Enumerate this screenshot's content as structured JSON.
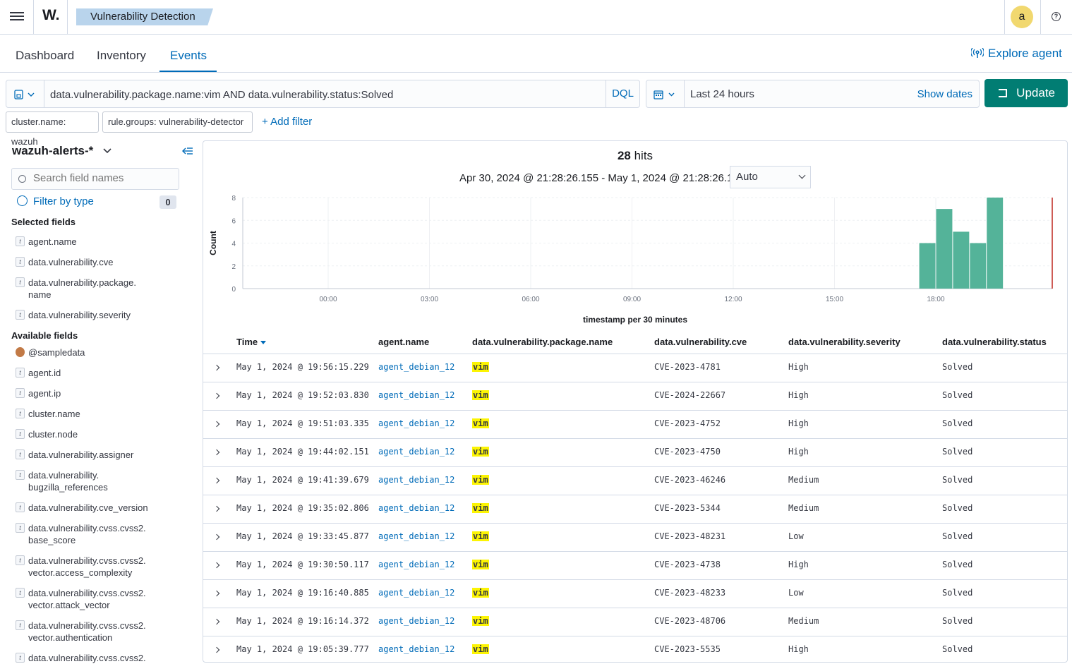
{
  "header": {
    "logo": "W.",
    "breadcrumb": "Vulnerability Detection",
    "avatar_initial": "a",
    "help_icon": "?"
  },
  "tabs": [
    {
      "label": "Dashboard",
      "active": false
    },
    {
      "label": "Inventory",
      "active": false
    },
    {
      "label": "Events",
      "active": true
    }
  ],
  "explore_agent": "Explore agent",
  "query": {
    "text": "data.vulnerability.package.name:vim AND data.vulnerability.status:Solved",
    "language": "DQL"
  },
  "date_picker": {
    "range": "Last 24 hours",
    "show_dates": "Show dates",
    "update": "Update"
  },
  "filters": [
    "cluster.name: wazuh",
    "rule.groups: vulnerability-detector"
  ],
  "add_filter": "+ Add filter",
  "sidebar": {
    "index_pattern": "wazuh-alerts-*",
    "search_placeholder": "Search field names",
    "filter_by_type": "Filter by type",
    "filter_count": "0",
    "selected_title": "Selected fields",
    "selected_fields": [
      "agent.name",
      "data.vulnerability.cve",
      "data.vulnerability.package.\nname",
      "data.vulnerability.severity"
    ],
    "available_title": "Available fields",
    "available_fields": [
      "@sampledata",
      "agent.id",
      "agent.ip",
      "cluster.name",
      "cluster.node",
      "data.vulnerability.assigner",
      "data.vulnerability.\nbugzilla_references",
      "data.vulnerability.cve_version",
      "data.vulnerability.cvss.cvss2.\nbase_score",
      "data.vulnerability.cvss.cvss2.\nvector.access_complexity",
      "data.vulnerability.cvss.cvss2.\nvector.attack_vector",
      "data.vulnerability.cvss.cvss2.\nvector.authentication",
      "data.vulnerability.cvss.cvss2."
    ]
  },
  "histogram": {
    "hits_count": "28",
    "hits_label": "hits",
    "date_range": "Apr 30, 2024 @ 21:28:26.155 - May 1, 2024 @ 21:28:26.155",
    "interval": "Auto"
  },
  "chart_data": {
    "type": "bar",
    "xlabel": "timestamp per 30 minutes",
    "ylabel": "Count",
    "ylim": [
      0,
      8
    ],
    "yticks": [
      "0",
      "2",
      "4",
      "6",
      "8"
    ],
    "xticks": [
      "00:00",
      "03:00",
      "06:00",
      "09:00",
      "12:00",
      "15:00",
      "18:00"
    ],
    "categories": [
      "17:30",
      "18:00",
      "18:30",
      "19:00",
      "19:30"
    ],
    "values": [
      4,
      7,
      5,
      4,
      8
    ],
    "color": "#54b399",
    "now_marker_color": "#bd271e"
  },
  "table": {
    "columns": [
      "Time",
      "agent.name",
      "data.vulnerability.package.name",
      "data.vulnerability.cve",
      "data.vulnerability.severity",
      "data.vulnerability.status"
    ],
    "rows": [
      [
        "May 1, 2024 @ 19:56:15.229",
        "agent_debian_12",
        "vim",
        "CVE-2023-4781",
        "High",
        "Solved"
      ],
      [
        "May 1, 2024 @ 19:52:03.830",
        "agent_debian_12",
        "vim",
        "CVE-2024-22667",
        "High",
        "Solved"
      ],
      [
        "May 1, 2024 @ 19:51:03.335",
        "agent_debian_12",
        "vim",
        "CVE-2023-4752",
        "High",
        "Solved"
      ],
      [
        "May 1, 2024 @ 19:44:02.151",
        "agent_debian_12",
        "vim",
        "CVE-2023-4750",
        "High",
        "Solved"
      ],
      [
        "May 1, 2024 @ 19:41:39.679",
        "agent_debian_12",
        "vim",
        "CVE-2023-46246",
        "Medium",
        "Solved"
      ],
      [
        "May 1, 2024 @ 19:35:02.806",
        "agent_debian_12",
        "vim",
        "CVE-2023-5344",
        "Medium",
        "Solved"
      ],
      [
        "May 1, 2024 @ 19:33:45.877",
        "agent_debian_12",
        "vim",
        "CVE-2023-48231",
        "Low",
        "Solved"
      ],
      [
        "May 1, 2024 @ 19:30:50.117",
        "agent_debian_12",
        "vim",
        "CVE-2023-4738",
        "High",
        "Solved"
      ],
      [
        "May 1, 2024 @ 19:16:40.885",
        "agent_debian_12",
        "vim",
        "CVE-2023-48233",
        "Low",
        "Solved"
      ],
      [
        "May 1, 2024 @ 19:16:14.372",
        "agent_debian_12",
        "vim",
        "CVE-2023-48706",
        "Medium",
        "Solved"
      ],
      [
        "May 1, 2024 @ 19:05:39.777",
        "agent_debian_12",
        "vim",
        "CVE-2023-5535",
        "High",
        "Solved"
      ]
    ]
  }
}
